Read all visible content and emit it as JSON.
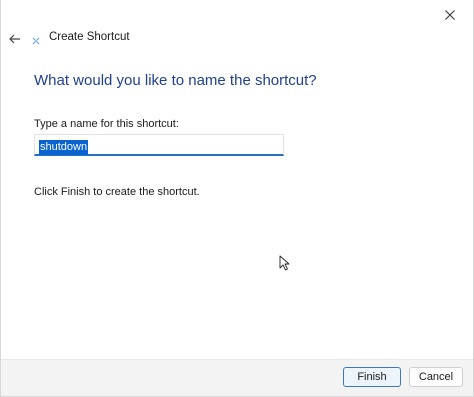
{
  "window": {
    "title": "Create Shortcut"
  },
  "icons": {
    "close": "close-icon",
    "back": "back-arrow-icon",
    "wizard": "shortcut-wizard-icon",
    "cursor": "mouse-pointer-icon"
  },
  "page": {
    "heading": "What would you like to name the shortcut?",
    "field_label": "Type a name for this shortcut:",
    "name_value": "shutdown",
    "instruction": "Click Finish to create the shortcut."
  },
  "buttons": {
    "finish": "Finish",
    "cancel": "Cancel"
  },
  "colors": {
    "heading": "#1f3f8f",
    "focus_underline": "#2a6fcc",
    "selection": "#0a64d0",
    "footer_bg": "#f3f3f3"
  }
}
